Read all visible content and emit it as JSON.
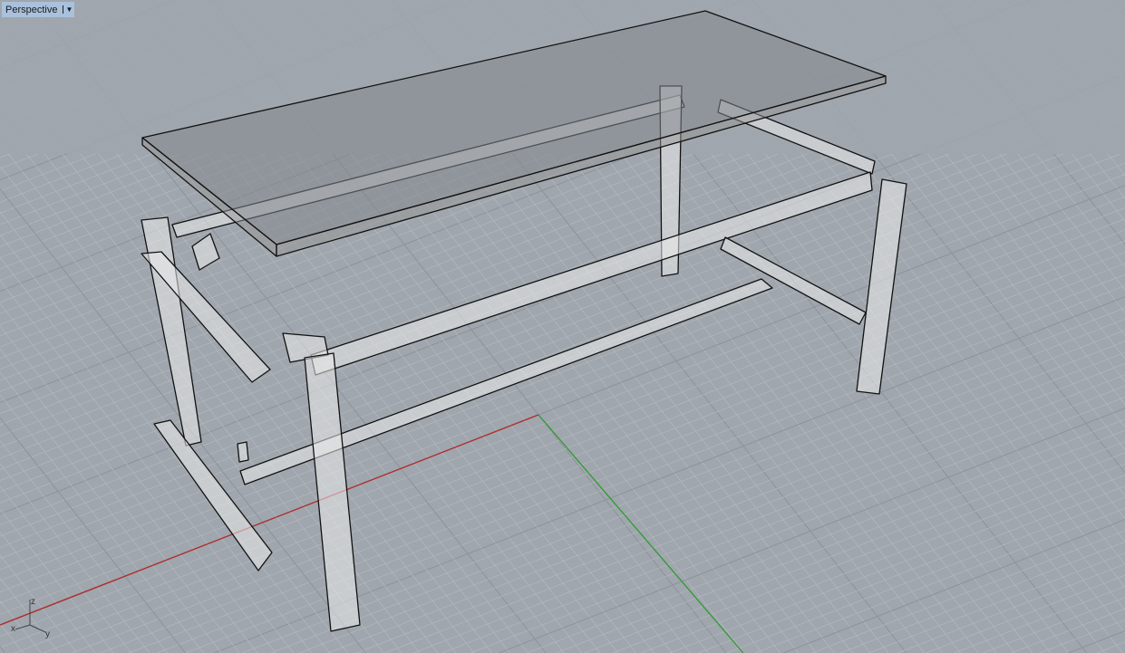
{
  "viewport": {
    "name": "Perspective",
    "menu_icon": "dropdown-arrow-icon",
    "axis_labels": {
      "x": "x",
      "y": "y",
      "z": "z"
    }
  },
  "colors": {
    "background": "#a0a6ad",
    "grid_minor": "#b3b8be",
    "grid_major": "#8d939a",
    "x_axis": "#b02a2a",
    "y_axis": "#2f9a33",
    "tab": "#a9c1dc"
  }
}
